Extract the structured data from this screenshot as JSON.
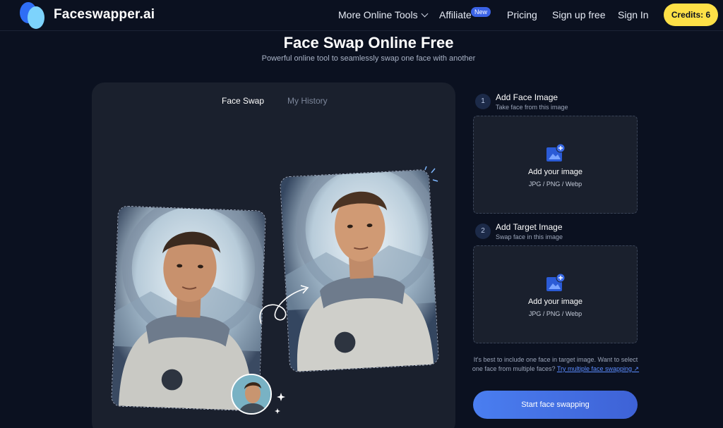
{
  "nav": {
    "brand": "Faceswapper.ai",
    "links": {
      "more_tools": "More Online Tools",
      "affiliate": "Affiliate",
      "new_badge": "New",
      "pricing": "Pricing",
      "signup": "Sign up free",
      "signin": "Sign In"
    },
    "credits": "Credits: 6"
  },
  "hero": {
    "title": "Face Swap Online Free",
    "subtitle": "Powerful online tool to seamlessly swap one face with another"
  },
  "panel": {
    "tabs": [
      {
        "label": "Face Swap",
        "active": true
      },
      {
        "label": "My History",
        "active": false
      }
    ]
  },
  "steps": [
    {
      "number": "1",
      "title": "Add Face Image",
      "subtitle": "Take face from this image",
      "dropzone_label": "Add your image",
      "formats": "JPG / PNG / Webp"
    },
    {
      "number": "2",
      "title": "Add Target Image",
      "subtitle": "Swap face in this image",
      "dropzone_label": "Add your image",
      "formats": "JPG / PNG / Webp"
    }
  ],
  "note": {
    "text": "It's best to include one face in target image. Want to select one face from multiple faces?",
    "link": "Try multiple face swapping ↗"
  },
  "actions": {
    "start": "Start face swapping"
  },
  "colors": {
    "background": "#0b1120",
    "panel": "#1a202d",
    "accent": "#4a7ef0",
    "credits": "#fde047",
    "badge": "#3b63e6"
  }
}
